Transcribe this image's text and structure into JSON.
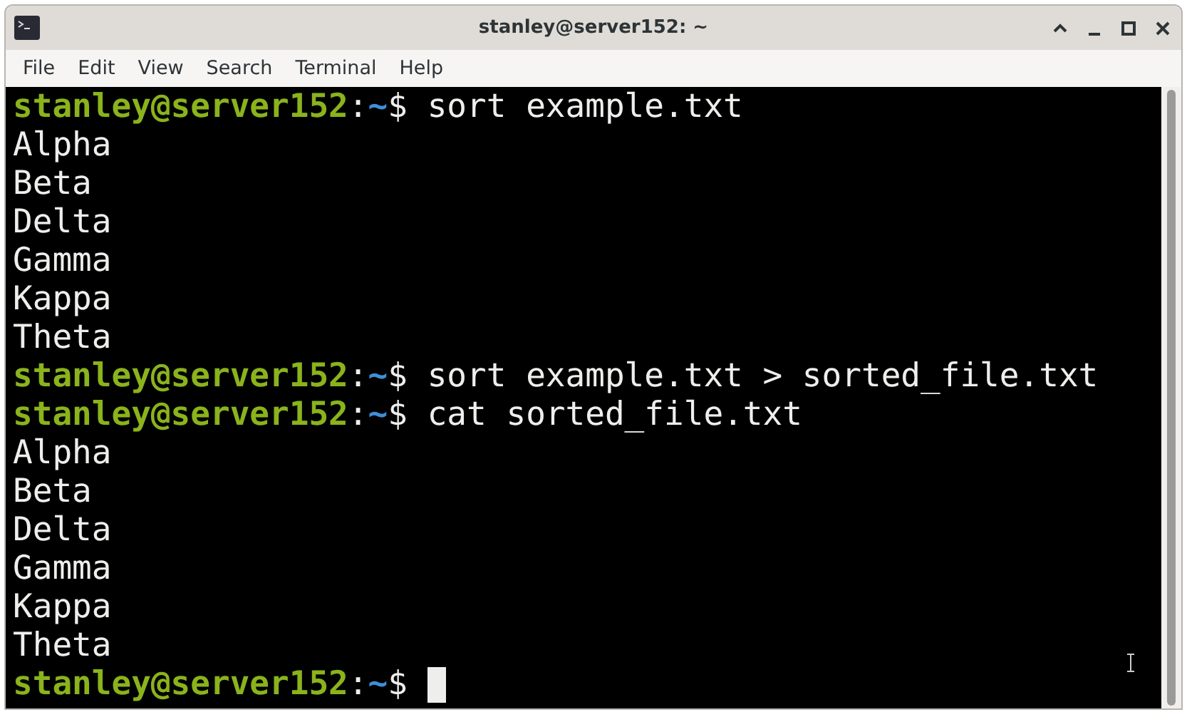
{
  "window": {
    "title": "stanley@server152: ~"
  },
  "menu": [
    "File",
    "Edit",
    "View",
    "Search",
    "Terminal",
    "Help"
  ],
  "terminal": {
    "lines": [
      {
        "kind": "prompt",
        "user": "stanley@server152",
        "sep": ":",
        "path": "~",
        "symbol": "$",
        "command": "sort example.txt"
      },
      {
        "kind": "output",
        "text": "Alpha"
      },
      {
        "kind": "output",
        "text": "Beta"
      },
      {
        "kind": "output",
        "text": "Delta"
      },
      {
        "kind": "output",
        "text": "Gamma"
      },
      {
        "kind": "output",
        "text": "Kappa"
      },
      {
        "kind": "output",
        "text": "Theta"
      },
      {
        "kind": "prompt",
        "user": "stanley@server152",
        "sep": ":",
        "path": "~",
        "symbol": "$",
        "command": "sort example.txt > sorted_file.txt"
      },
      {
        "kind": "prompt",
        "user": "stanley@server152",
        "sep": ":",
        "path": "~",
        "symbol": "$",
        "command": "cat sorted_file.txt"
      },
      {
        "kind": "output",
        "text": "Alpha"
      },
      {
        "kind": "output",
        "text": "Beta"
      },
      {
        "kind": "output",
        "text": "Delta"
      },
      {
        "kind": "output",
        "text": "Gamma"
      },
      {
        "kind": "output",
        "text": "Kappa"
      },
      {
        "kind": "output",
        "text": "Theta"
      },
      {
        "kind": "prompt",
        "user": "stanley@server152",
        "sep": ":",
        "path": "~",
        "symbol": "$",
        "cursor": true
      }
    ]
  }
}
